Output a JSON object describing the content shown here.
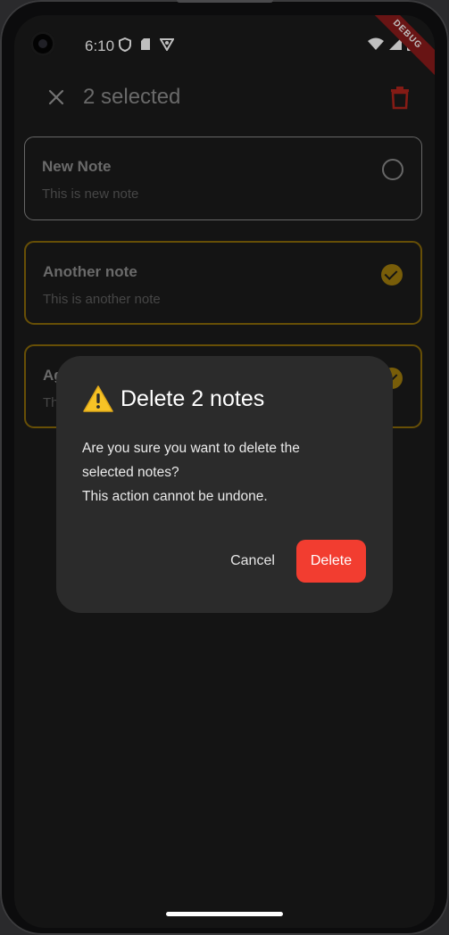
{
  "status_bar": {
    "time": "6:10",
    "left_icons": [
      "shield-icon",
      "sd-card-icon",
      "vpn-icon"
    ],
    "right_icons": [
      "wifi-icon",
      "signal-icon",
      "battery-icon"
    ],
    "debug_label": "DEBUG"
  },
  "appbar": {
    "title": "2 selected",
    "close_icon": "close-icon",
    "delete_icon": "trash-icon",
    "delete_icon_color": "#b1251c"
  },
  "notes": [
    {
      "title": "New Note",
      "body": "This is new note",
      "selected": false
    },
    {
      "title": "Another note",
      "body": "This is another note",
      "selected": true
    },
    {
      "title": "Ag",
      "body": "Th",
      "selected": true
    }
  ],
  "dialog": {
    "title": "Delete 2 notes",
    "icon": "warning-icon",
    "message_lines": [
      "Are you sure you want to delete the",
      "selected notes?",
      "This action cannot be undone."
    ],
    "cancel_label": "Cancel",
    "delete_label": "Delete",
    "delete_color": "#f23d30"
  },
  "colors": {
    "background": "#1b1b1b",
    "selected_accent": "#a07c0d"
  }
}
